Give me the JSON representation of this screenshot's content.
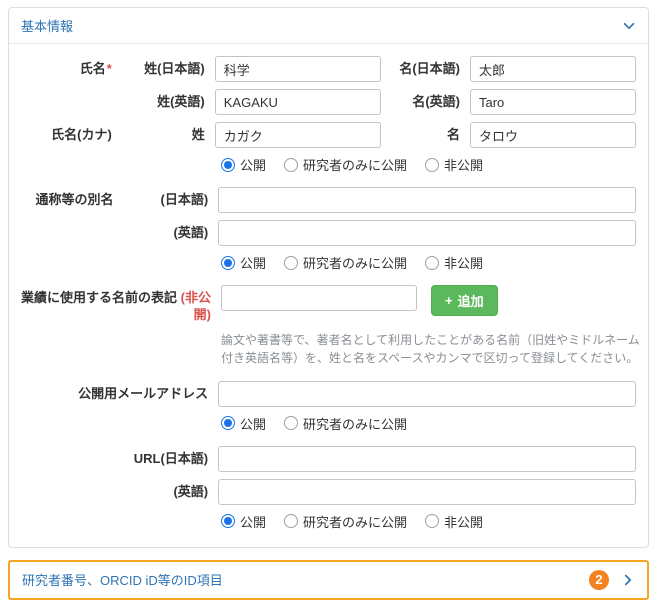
{
  "basic_panel": {
    "title": "基本情報"
  },
  "name": {
    "label": "氏名",
    "required_mark": "*",
    "ja_last_label": "姓(日本語)",
    "ja_last_value": "科学",
    "ja_first_label": "名(日本語)",
    "ja_first_value": "太郎",
    "en_last_label": "姓(英語)",
    "en_last_value": "KAGAKU",
    "en_first_label": "名(英語)",
    "en_first_value": "Taro"
  },
  "kana": {
    "label": "氏名(カナ)",
    "last_label": "姓",
    "last_value": "カガク",
    "first_label": "名",
    "first_value": "タロウ"
  },
  "alias": {
    "label": "通称等の別名",
    "ja_label": "(日本語)",
    "ja_value": "",
    "en_label": "(英語)",
    "en_value": ""
  },
  "works_name": {
    "label": "業績に使用する名前の表記 ",
    "privacy_note": "(非公開)",
    "value": "",
    "add_button_label": "追加",
    "plus_icon": "+",
    "help_text": "論文や著書等で、著者名として利用したことがある名前（旧姓やミドルネーム付き英語名等）を、姓と名をスペースやカンマで区切って登録してください。"
  },
  "email": {
    "label": "公開用メールアドレス",
    "value": ""
  },
  "url": {
    "ja_label": "URL(日本語)",
    "ja_value": "",
    "en_label": "(英語)",
    "en_value": ""
  },
  "radio_labels": {
    "public": "公開",
    "researchers_only": "研究者のみに公開",
    "private": "非公開"
  },
  "id_panel": {
    "title": "研究者番号、ORCID iD等のID項目",
    "badge": "2"
  },
  "colors": {
    "accent_blue": "#2e75b6",
    "button_green": "#5cb85c",
    "required_red": "#d9534f",
    "highlight_orange": "#f5a623",
    "badge_orange": "#f58220",
    "radio_blue": "#1a73e8"
  }
}
